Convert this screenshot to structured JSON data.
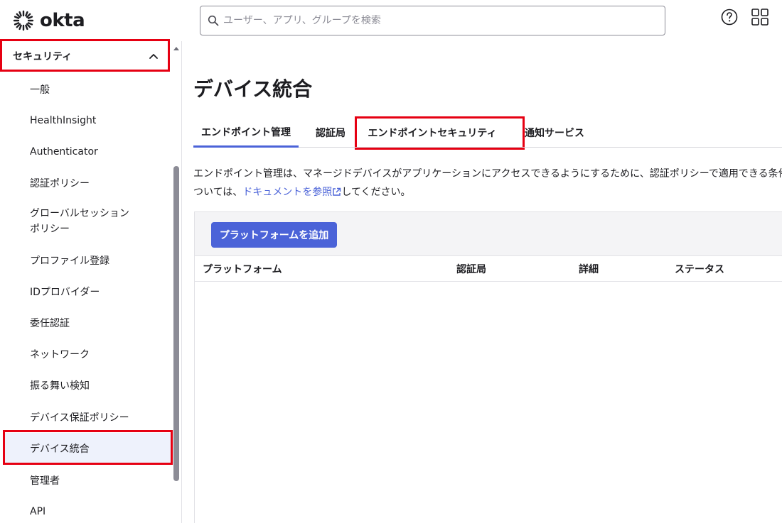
{
  "brand": {
    "name": "okta",
    "accent": "#4b63d8",
    "highlight": "#e60012"
  },
  "search": {
    "placeholder": "ユーザー、アプリ、グループを検索",
    "icon": "search-icon"
  },
  "header_icons": [
    "help-icon",
    "app-grid-icon"
  ],
  "sidebar": {
    "section_title": "セキュリティ",
    "items": [
      {
        "label": "一般"
      },
      {
        "label": "HealthInsight"
      },
      {
        "label": "Authenticator"
      },
      {
        "label": "認証ポリシー"
      },
      {
        "label": "グローバルセッション",
        "label2": "ポリシー"
      },
      {
        "label": "プロファイル登録"
      },
      {
        "label": "IDプロバイダー"
      },
      {
        "label": "委任認証"
      },
      {
        "label": "ネットワーク"
      },
      {
        "label": "振る舞い検知"
      },
      {
        "label": "デバイス保証ポリシー"
      },
      {
        "label": "デバイス統合"
      },
      {
        "label": "管理者"
      },
      {
        "label": "API"
      }
    ],
    "active_item": "デバイス統合"
  },
  "main": {
    "title": "デバイス統合",
    "tabs": [
      {
        "label": "エンドポイント管理"
      },
      {
        "label": "認証局"
      },
      {
        "label": "エンドポイントセキュリティ"
      },
      {
        "label": "通知サービス"
      }
    ],
    "active_tab": "エンドポイント管理",
    "description_line1": "エンドポイント管理は、マネージドデバイスがアプリケーションにアクセスできるようにするために、認証ポリシーで適用できる条件",
    "description_line2_prefix": "ついては、",
    "description_link": "ドキュメントを参照",
    "description_line2_suffix": "してください。",
    "add_button": "プラットフォームを追加",
    "table_headers": [
      "プラットフォーム",
      "認証局",
      "詳細",
      "ステータス"
    ]
  }
}
